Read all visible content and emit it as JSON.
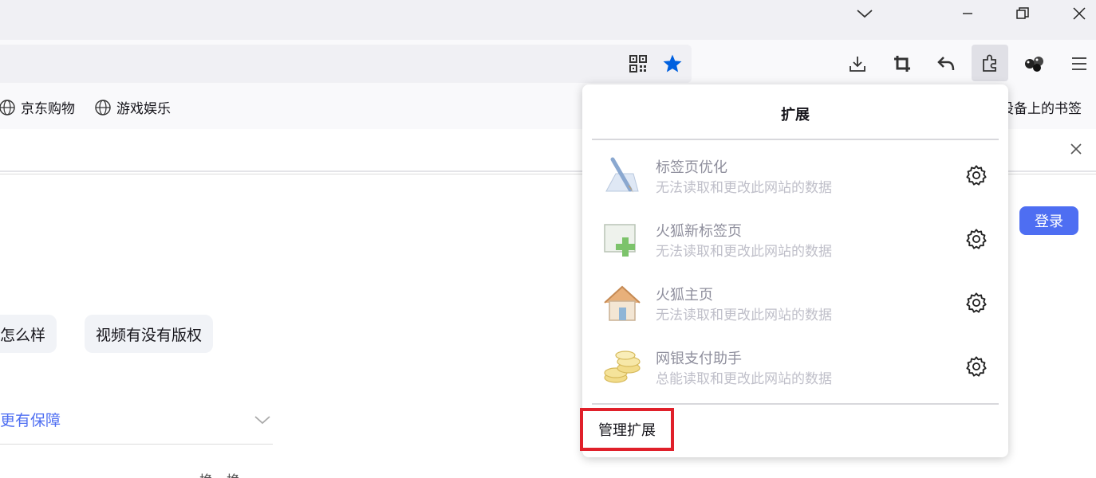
{
  "bookmarks": {
    "items": [
      {
        "label": "京东购物",
        "icon": "globe-icon"
      },
      {
        "label": "游戏娱乐",
        "icon": "globe-icon"
      }
    ],
    "right_label": "设备上的书签"
  },
  "page": {
    "login_label": "登录",
    "chips": [
      "怎么样",
      "视频有没有版权"
    ],
    "guarantee_text": "更有保障",
    "footer_fragment": "换一换"
  },
  "extensions_panel": {
    "title": "扩展",
    "items": [
      {
        "name": "标签页优化",
        "desc": "无法读取和更改此网站的数据",
        "icon": "tab-optimize-icon"
      },
      {
        "name": "火狐新标签页",
        "desc": "无法读取和更改此网站的数据",
        "icon": "new-tab-plus-icon"
      },
      {
        "name": "火狐主页",
        "desc": "无法读取和更改此网站的数据",
        "icon": "home-icon"
      },
      {
        "name": "网银支付助手",
        "desc": "总能读取和更改此网站的数据",
        "icon": "coins-icon"
      }
    ],
    "manage_label": "管理扩展"
  },
  "colors": {
    "accent_blue": "#4e6ef2",
    "star_blue": "#0060df",
    "highlight_red": "#e0202a"
  }
}
